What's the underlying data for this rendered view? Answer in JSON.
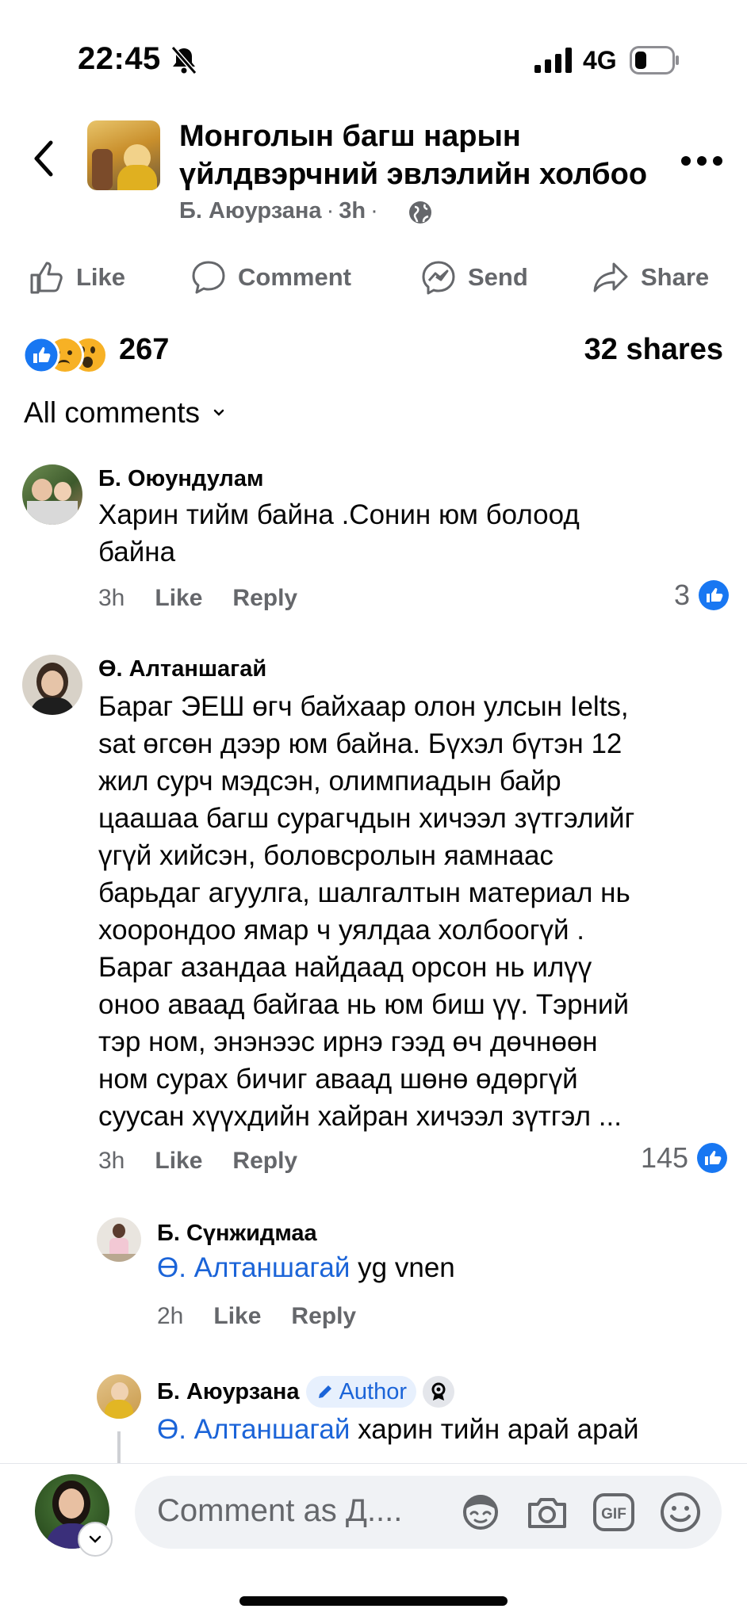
{
  "status_bar": {
    "time": "22:45",
    "network": "4G"
  },
  "header": {
    "title_line1": "Монголын багш нарын",
    "title_line2": "үйлдвэрчний эвлэлийн холбоо",
    "author": "Б. Аюурзана",
    "time": "3h"
  },
  "actions": {
    "like": "Like",
    "comment": "Comment",
    "send": "Send",
    "share": "Share"
  },
  "stats": {
    "reactions": "267",
    "shares": "32 shares"
  },
  "comments_header": "All comments",
  "comments": [
    {
      "name": "Б. Оюундулам",
      "lines": [
        "Харин тийм байна .Сонин юм болоод",
        "байна"
      ],
      "time": "3h",
      "like": "Like",
      "reply": "Reply",
      "likes": "3"
    },
    {
      "name": "Ө. Алтаншагай",
      "lines": [
        "Бараг ЭЕШ өгч байхаар олон улсын Ielts,",
        "sat өгсөн дээр юм байна.  Бүхэл бүтэн 12",
        "жил сурч мэдсэн, олимпиадын байр",
        "цаашаа багш сурагчдын хичээл зүтгэлийг",
        "үгүй хийсэн, боловсролын яамнаас",
        "барьдаг агуулга, шалгалтын материал нь",
        "хоорондоо ямар ч уялдаа холбоогүй .",
        "Бараг азандаа найдаад орсон нь илүү",
        "оноо аваад байгаа нь юм биш үү. Тэрний",
        "тэр ном, энэнээс ирнэ гээд өч дөчнөөн",
        "ном сурах бичиг аваад шөнө өдөргүй",
        "суусан хүүхдийн хайран хичээл зүтгэл ..."
      ],
      "time": "3h",
      "like": "Like",
      "reply": "Reply",
      "likes": "145"
    }
  ],
  "replies": [
    {
      "name": "Б. Сүнжидмаа",
      "mention": "Ө. Алтаншагай",
      "text": " yg vnen",
      "time": "2h",
      "like": "Like",
      "reply": "Reply"
    },
    {
      "name": "Б. Аюурзана",
      "badge": "Author",
      "mention": "Ө. Алтаншагай",
      "text": " харин тийн арай арай"
    }
  ],
  "composer": {
    "placeholder": "Comment as Д...."
  },
  "colors": {
    "blue": "#1b64d8",
    "gray": "#65676b",
    "reaction_like": "#1877f2"
  }
}
